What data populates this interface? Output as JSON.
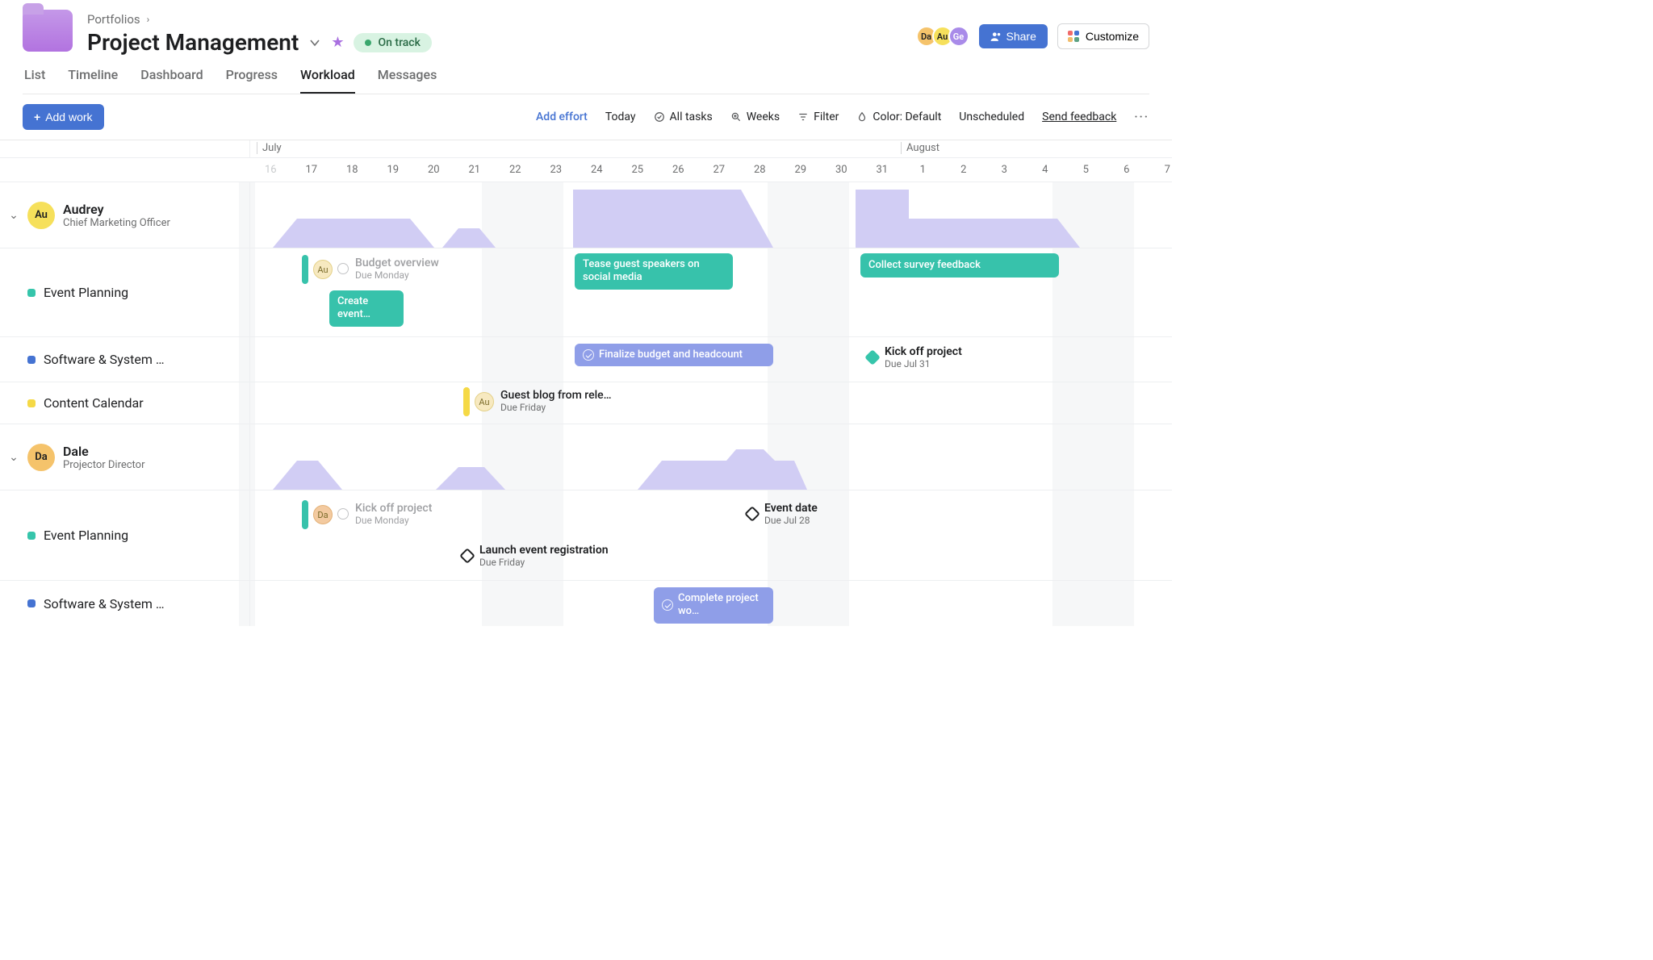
{
  "breadcrumb": {
    "root": "Portfolios"
  },
  "title": "Project Management",
  "status": {
    "label": "On track"
  },
  "avatars": {
    "da": "Da",
    "au": "Au",
    "ge": "Ge"
  },
  "header_buttons": {
    "share": "Share",
    "customize": "Customize"
  },
  "tabs": {
    "list": "List",
    "timeline": "Timeline",
    "dashboard": "Dashboard",
    "progress": "Progress",
    "workload": "Workload",
    "messages": "Messages"
  },
  "toolbar": {
    "add_work": "Add work",
    "add_effort": "Add effort",
    "today": "Today",
    "all_tasks": "All tasks",
    "weeks": "Weeks",
    "filter": "Filter",
    "color": "Color: Default",
    "unscheduled": "Unscheduled",
    "send_feedback": "Send feedback"
  },
  "months": {
    "july": "July",
    "august": "August"
  },
  "days": [
    "16",
    "17",
    "18",
    "19",
    "20",
    "21",
    "22",
    "23",
    "24",
    "25",
    "26",
    "27",
    "28",
    "29",
    "30",
    "31",
    "1",
    "2",
    "3",
    "4",
    "5",
    "6",
    "7"
  ],
  "people": {
    "audrey": {
      "name": "Audrey",
      "role": "Chief Marketing Officer",
      "initials": "Au"
    },
    "dale": {
      "name": "Dale",
      "role": "Projector Director",
      "initials": "Da"
    }
  },
  "projects": {
    "event_planning": "Event Planning",
    "software": "Software & System …",
    "content_calendar": "Content Calendar"
  },
  "tasks": {
    "budget_overview": {
      "title": "Budget overview",
      "sub": "Due Monday"
    },
    "create_event": {
      "title": "Create event…"
    },
    "tease_speakers": {
      "title": "Tease guest speakers on social media"
    },
    "collect_survey": {
      "title": "Collect survey feedback"
    },
    "finalize_budget": {
      "title": "Finalize budget and headcount"
    },
    "kick_off": {
      "title": "Kick off project",
      "sub": "Due Jul 31"
    },
    "guest_blog": {
      "title": "Guest blog from rele…",
      "sub": "Due Friday"
    },
    "kick_off_dale": {
      "title": "Kick off project",
      "sub": "Due Monday"
    },
    "event_date": {
      "title": "Event date",
      "sub": "Due Jul 28"
    },
    "launch_reg": {
      "title": "Launch event registration",
      "sub": "Due Friday"
    },
    "complete_project": {
      "title": "Complete project wo…"
    }
  }
}
